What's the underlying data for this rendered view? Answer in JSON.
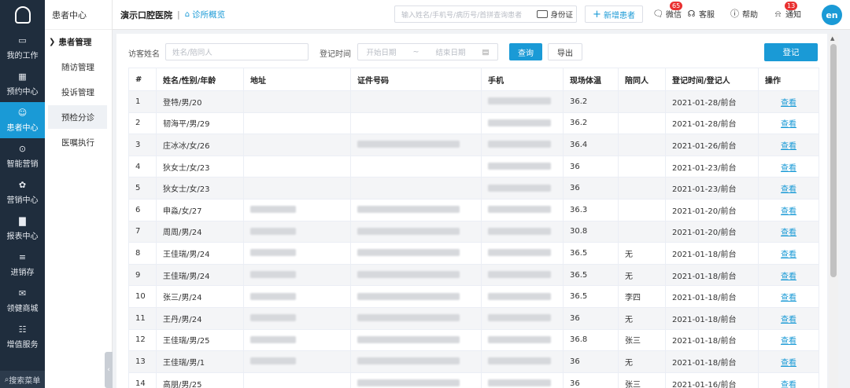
{
  "rail": {
    "items": [
      {
        "label": "我的工作",
        "icon": "monitor-icon"
      },
      {
        "label": "预约中心",
        "icon": "calendar-icon"
      },
      {
        "label": "患者中心",
        "icon": "user-icon"
      },
      {
        "label": "智能营销",
        "icon": "marketing-icon"
      },
      {
        "label": "营销中心",
        "icon": "flower-icon"
      },
      {
        "label": "报表中心",
        "icon": "bar-chart-icon"
      },
      {
        "label": "进销存",
        "icon": "layers-icon"
      },
      {
        "label": "领健商城",
        "icon": "mail-icon"
      },
      {
        "label": "增值服务",
        "icon": "grid-icon"
      }
    ],
    "active_index": 2,
    "search_label": "搜索菜单"
  },
  "subnav": {
    "title": "患者中心",
    "group": "患者管理",
    "items": [
      "随访管理",
      "投诉管理",
      "预检分诊",
      "医嘱执行"
    ],
    "active_index": 2
  },
  "header": {
    "clinic": "演示口腔医院",
    "overview": "诊所概览",
    "search_placeholder": "输入姓名/手机号/病历号/首拼查询患者",
    "idcard_label": "身份证",
    "new_patient": "新增患者",
    "wechat": "微信",
    "wechat_badge": "65",
    "service": "客服",
    "help": "帮助",
    "notice": "通知",
    "notice_badge": "13",
    "avatar": "en"
  },
  "filters": {
    "visitor_label": "访客姓名",
    "visitor_placeholder": "姓名/陪同人",
    "time_label": "登记时间",
    "start_placeholder": "开始日期",
    "range_sep": "~",
    "end_placeholder": "结束日期",
    "query": "查询",
    "export": "导出",
    "register": "登记"
  },
  "table": {
    "columns": [
      "#",
      "姓名/性别/年龄",
      "地址",
      "证件号码",
      "手机",
      "现场体温",
      "陪同人",
      "登记时间/登记人",
      "操作"
    ],
    "action_label": "查看",
    "rows": [
      {
        "no": "1",
        "name": "登特/男/20",
        "temp": "36.2",
        "companion": "",
        "time": "2021-01-28/前台",
        "addr": 0,
        "id": 0,
        "phone": 1
      },
      {
        "no": "2",
        "name": "韧海平/男/29",
        "temp": "36.2",
        "companion": "",
        "time": "2021-01-28/前台",
        "addr": 0,
        "id": 0,
        "phone": 1
      },
      {
        "no": "3",
        "name": "庄冰冰/女/26",
        "temp": "36.4",
        "companion": "",
        "time": "2021-01-26/前台",
        "addr": 0,
        "id": 1,
        "phone": 1
      },
      {
        "no": "4",
        "name": "狄女士/女/23",
        "temp": "36",
        "companion": "",
        "time": "2021-01-23/前台",
        "addr": 0,
        "id": 0,
        "phone": 1
      },
      {
        "no": "5",
        "name": "狄女士/女/23",
        "temp": "36",
        "companion": "",
        "time": "2021-01-23/前台",
        "addr": 0,
        "id": 0,
        "phone": 1
      },
      {
        "no": "6",
        "name": "申淼/女/27",
        "temp": "36.3",
        "companion": "",
        "time": "2021-01-20/前台",
        "addr": 1,
        "id": 1,
        "phone": 1
      },
      {
        "no": "7",
        "name": "周周/男/24",
        "temp": "30.8",
        "companion": "",
        "time": "2021-01-20/前台",
        "addr": 1,
        "id": 1,
        "phone": 1
      },
      {
        "no": "8",
        "name": "王佳瑞/男/24",
        "temp": "36.5",
        "companion": "无",
        "time": "2021-01-18/前台",
        "addr": 1,
        "id": 1,
        "phone": 1
      },
      {
        "no": "9",
        "name": "王佳瑞/男/24",
        "temp": "36.5",
        "companion": "无",
        "time": "2021-01-18/前台",
        "addr": 1,
        "id": 1,
        "phone": 1
      },
      {
        "no": "10",
        "name": "张三/男/24",
        "temp": "36.5",
        "companion": "李四",
        "time": "2021-01-18/前台",
        "addr": 1,
        "id": 1,
        "phone": 1
      },
      {
        "no": "11",
        "name": "王丹/男/24",
        "temp": "36",
        "companion": "无",
        "time": "2021-01-18/前台",
        "addr": 1,
        "id": 1,
        "phone": 1
      },
      {
        "no": "12",
        "name": "王佳瑞/男/25",
        "temp": "36.8",
        "companion": "张三",
        "time": "2021-01-18/前台",
        "addr": 1,
        "id": 1,
        "phone": 1
      },
      {
        "no": "13",
        "name": "王佳瑞/男/1",
        "temp": "36",
        "companion": "无",
        "time": "2021-01-18/前台",
        "addr": 1,
        "id": 1,
        "phone": 1
      },
      {
        "no": "14",
        "name": "高朋/男/25",
        "temp": "36",
        "companion": "张三",
        "time": "2021-01-16/前台",
        "addr": 0,
        "id": 1,
        "phone": 1
      }
    ]
  }
}
